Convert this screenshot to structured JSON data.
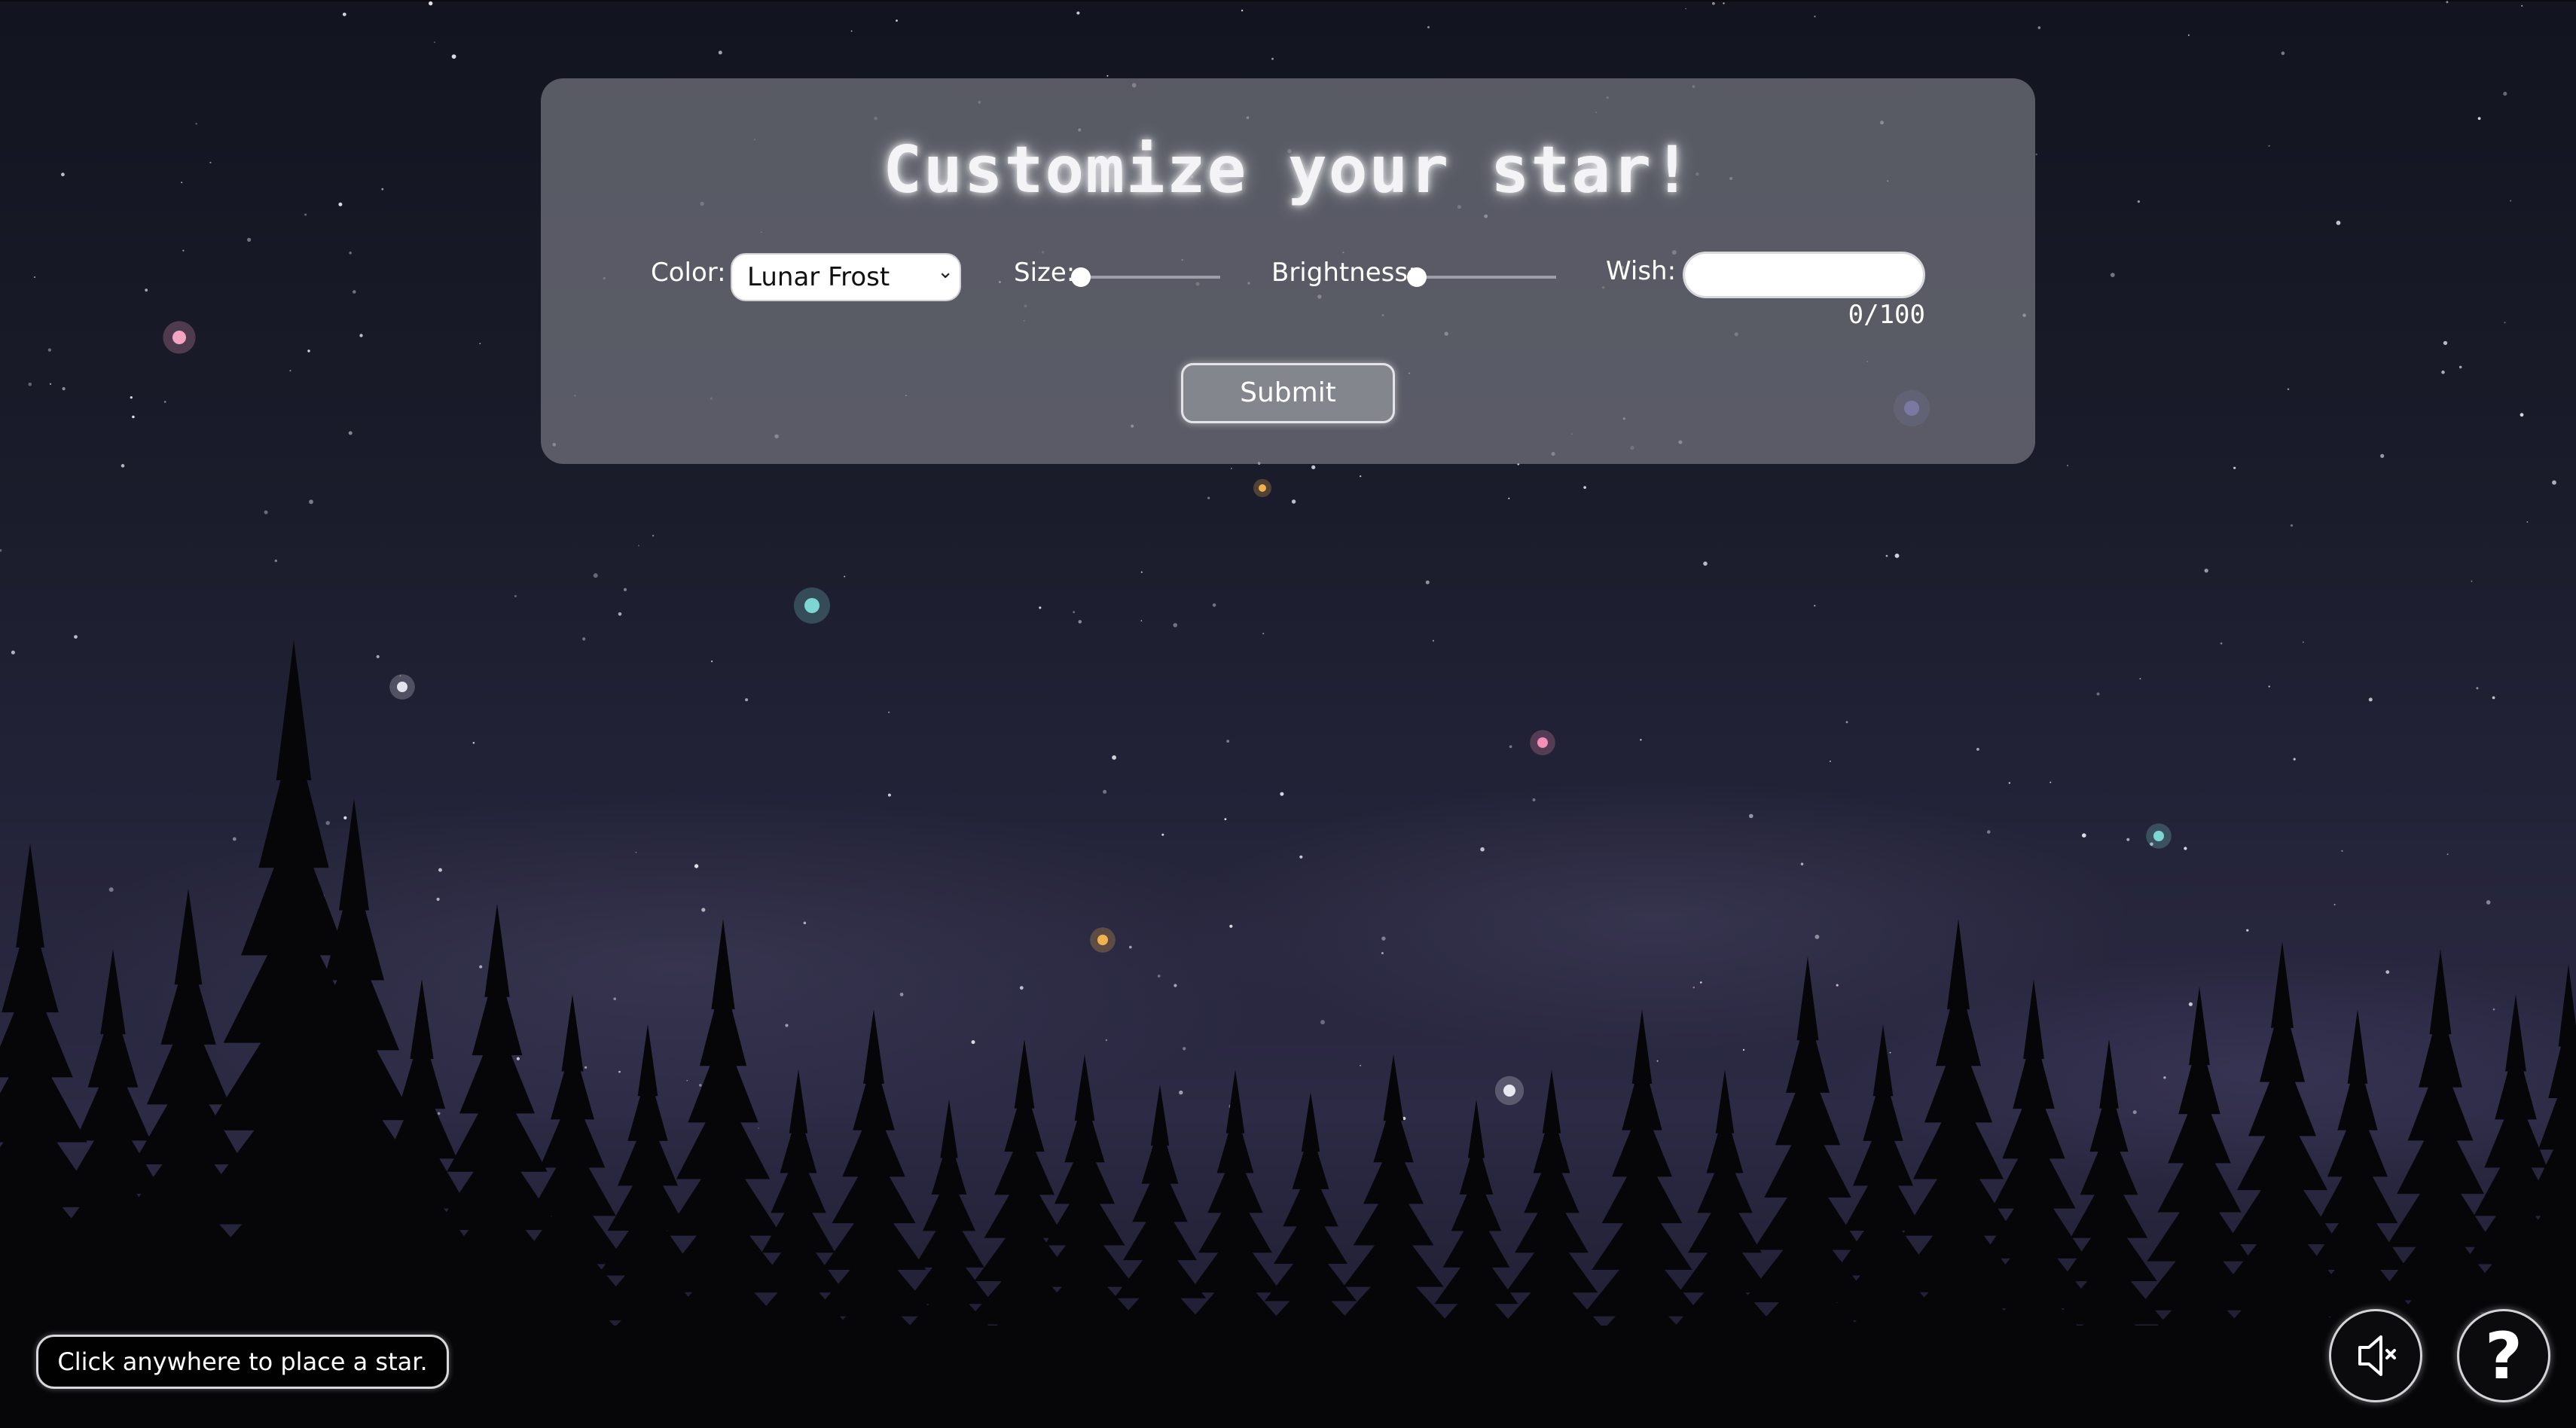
{
  "panel": {
    "title": "Customize your star!",
    "color_label": "Color:",
    "color_value": "Lunar Frost",
    "size_label": "Size:",
    "size_level": 0,
    "brightness_label": "Brightness:",
    "brightness_level": 0,
    "wish_label": "Wish:",
    "wish_value": "",
    "wish_counter": "0/100",
    "submit_label": "Submit"
  },
  "hint": "Click anywhere to place a star.",
  "controls": {
    "mute_icon": "speaker-muted-icon",
    "help_label": "?"
  },
  "placed_stars": [
    {
      "color": "#f2a6c4"
    },
    {
      "color": "#8f83ff"
    },
    {
      "color": "#f3b24e"
    },
    {
      "color": "#7ed6d2"
    },
    {
      "color": "#e4e4ee"
    },
    {
      "color": "#f58fb8"
    },
    {
      "color": "#7ed6d2"
    },
    {
      "color": "#f3b24e"
    },
    {
      "color": "#e8e8f0"
    }
  ],
  "colors": {
    "panel": "#73757e",
    "sky_top": "#12141f",
    "sky_bottom": "#2c2a44",
    "trees": "#060608"
  }
}
